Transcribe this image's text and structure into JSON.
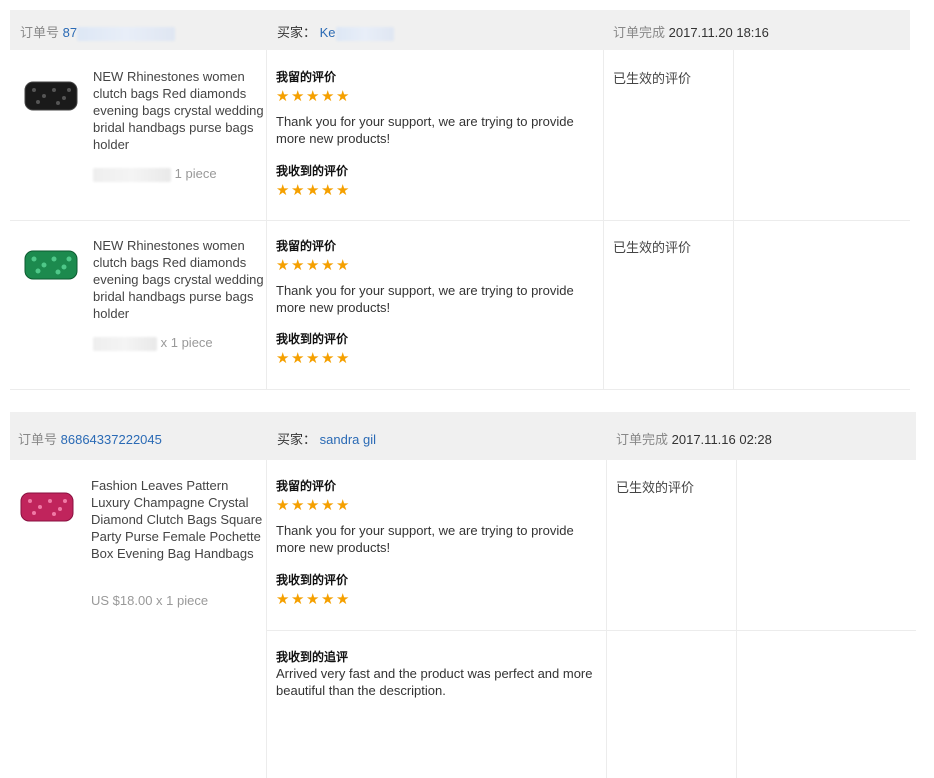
{
  "orders": [
    {
      "order_label": "订单号",
      "order_no": "87",
      "buyer_label": "买家：",
      "buyer_name": "Ke",
      "status_label": "订单完成",
      "time": "2017.11.20 18:16",
      "items": [
        {
          "title": "NEW Rhinestones women clutch bags Red diamonds evening bags crystal wedding bridal handbags purse bags holder",
          "qty": "1 piece",
          "my_review_label": "我留的评价",
          "my_review_text": "Thank you for your support, we are trying to provide more new products!",
          "received_review_label": "我收到的评价",
          "status": "已生效的评价",
          "image_color": "#1a1a1a"
        },
        {
          "title": "NEW Rhinestones women clutch bags Red diamonds evening bags crystal wedding bridal handbags purse bags holder",
          "qty": "x 1 piece",
          "my_review_label": "我留的评价",
          "my_review_text": "Thank you for your support, we are trying to provide more new products!",
          "received_review_label": "我收到的评价",
          "status": "已生效的评价",
          "image_color": "#1c8a4e"
        }
      ]
    },
    {
      "order_label": "订单号",
      "order_no": "86864337222045",
      "buyer_label": "买家：",
      "buyer_name": "sandra gil",
      "status_label": "订单完成",
      "time": "2017.11.16 02:28",
      "items": [
        {
          "title": "Fashion Leaves Pattern Luxury Champagne Crystal Diamond Clutch Bags Square Party Purse Female Pochette Box Evening Bag Handbags",
          "qty": "US $18.00 x 1 piece",
          "my_review_label": "我留的评价",
          "my_review_text": "Thank you for your support, we are trying to provide more new products!",
          "received_review_label": "我收到的评价",
          "status": "已生效的评价",
          "followup_label": "我收到的追评",
          "followup_text": "Arrived very fast and the product was perfect and more beautiful than the description.",
          "image_color": "#c0245c"
        }
      ]
    }
  ],
  "rating": 5,
  "star_color": "#f5a000",
  "link_color": "#2a6ab5"
}
